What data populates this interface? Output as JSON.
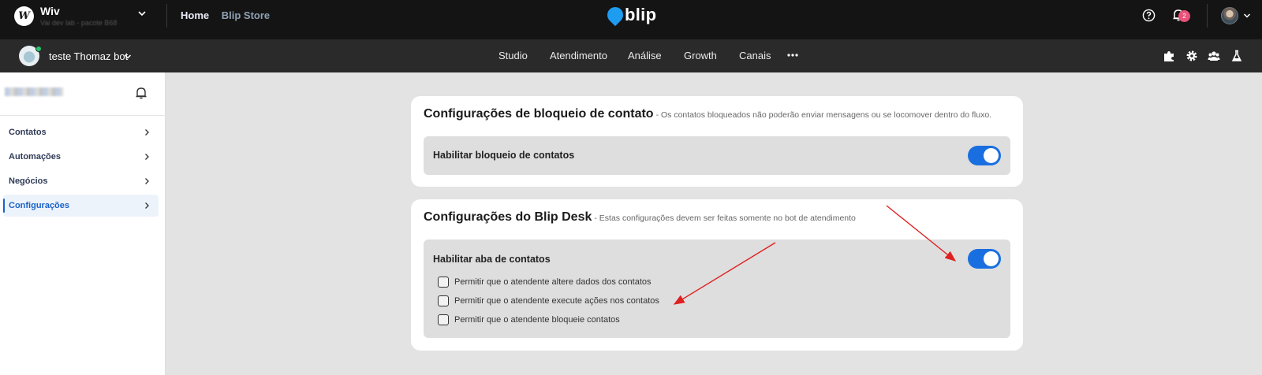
{
  "topbar": {
    "org_logo_text": "W",
    "org_name": "Wiv",
    "org_subtitle": "Vai dev lab - pacote B68",
    "nav": [
      {
        "label": "Home"
      },
      {
        "label": "Blip Store"
      }
    ],
    "brand": "blip",
    "notification_count": "2",
    "icons": [
      "chevron-down-icon",
      "help-icon",
      "bell-icon",
      "avatar"
    ]
  },
  "botbar": {
    "bot_name": "teste Thomaz bot",
    "nav": [
      {
        "label": "Studio"
      },
      {
        "label": "Atendimento"
      },
      {
        "label": "Análise"
      },
      {
        "label": "Growth"
      },
      {
        "label": "Canais"
      }
    ],
    "tools": [
      "puzzle-icon",
      "gear-icon",
      "team-icon",
      "flask-icon"
    ]
  },
  "sidebar": {
    "items": [
      {
        "label": "Contatos",
        "active": false
      },
      {
        "label": "Automações",
        "active": false
      },
      {
        "label": "Negócios",
        "active": false
      },
      {
        "label": "Configurações",
        "active": true
      }
    ]
  },
  "cards": {
    "block": {
      "title": "Configurações de bloqueio de contato",
      "subtitle": "- Os contatos bloqueados não poderão enviar mensagens ou se locomover dentro do fluxo.",
      "toggle_label": "Habilitar bloqueio de contatos",
      "toggle_on": true
    },
    "desk": {
      "title": "Configurações do Blip Desk",
      "subtitle": "- Estas configurações devem ser feitas somente no bot de atendimento",
      "toggle_label": "Habilitar aba de contatos",
      "toggle_on": true,
      "checkboxes": [
        {
          "label": "Permitir que o atendente altere dados dos contatos",
          "checked": false
        },
        {
          "label": "Permitir que o atendente execute ações nos contatos",
          "checked": false
        },
        {
          "label": "Permitir que o atendente bloqueie contatos",
          "checked": false
        }
      ]
    }
  },
  "colors": {
    "topbar_bg": "#141414",
    "botbar_bg": "#2a2a2a",
    "accent": "#1a6fe0",
    "active_sidebar": "#1a62c9",
    "badge": "#e9527a",
    "annotation_arrow": "#e02020"
  }
}
